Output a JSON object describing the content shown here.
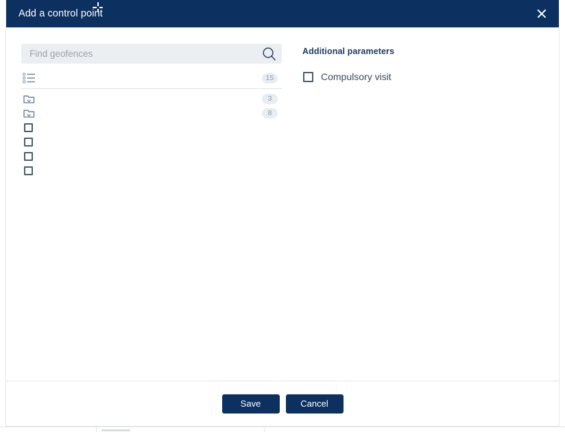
{
  "dialog": {
    "title": "Add a control point",
    "close_icon": "close-icon"
  },
  "search": {
    "placeholder": "Find geofences",
    "value": "",
    "icon": "search-icon"
  },
  "geofence_list": {
    "header": {
      "icon": "bulleted-list-icon",
      "label": "",
      "count": "15"
    },
    "rows": [
      {
        "type": "folder",
        "icon": "folder-collapsed-icon",
        "label": "",
        "count": "3"
      },
      {
        "type": "folder",
        "icon": "folder-collapsed-icon",
        "label": "",
        "count": "8"
      },
      {
        "type": "item",
        "icon": "checkbox-unchecked-icon",
        "label": "",
        "count": ""
      },
      {
        "type": "item",
        "icon": "checkbox-unchecked-icon",
        "label": "",
        "count": ""
      },
      {
        "type": "item",
        "icon": "checkbox-unchecked-icon",
        "label": "",
        "count": ""
      },
      {
        "type": "item",
        "icon": "checkbox-unchecked-icon",
        "label": "",
        "count": ""
      }
    ]
  },
  "additional_parameters": {
    "title": "Additional parameters",
    "options": [
      {
        "label": "Compulsory visit",
        "checked": false,
        "icon": "checkbox-unchecked-icon"
      }
    ]
  },
  "footer": {
    "save_label": "Save",
    "cancel_label": "Cancel"
  },
  "colors": {
    "header_navy": "#0c3160",
    "button_navy": "#0c3160",
    "accent_title": "#1f3a63",
    "badge_bg": "#e8edf3",
    "badge_text": "#8c9bab",
    "search_bg": "#eceff1",
    "checkbox_border": "#4a5b71"
  }
}
